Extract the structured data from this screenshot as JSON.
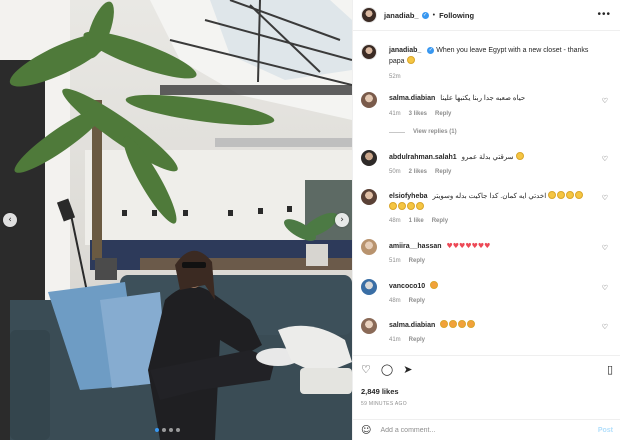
{
  "post": {
    "username": "janadiab_",
    "follow_status": "Following",
    "separator": "•",
    "more_icon": "more-horizontal-icon",
    "caption": "When you leave Egypt with a new closet - thanks papa",
    "caption_emoji": "face-emoji",
    "caption_time": "52m",
    "likes": "2,849 likes",
    "time_ago": "59 MINUTES AGO"
  },
  "comments": [
    {
      "user": "salma.diabian",
      "text": "حياه صعبه جدا ربنا يكتبها علينا",
      "time": "41m",
      "likes": "3 likes",
      "reply": "Reply"
    },
    {
      "user": "abdulrahman.salah1",
      "text": "سرقتي بدلة عمرو",
      "time": "50m",
      "likes": "2 likes",
      "reply": "Reply"
    },
    {
      "user": "elsiofyheba",
      "text": "اخدتي ايه كمان. كدا جاكيت بدله وسويتر",
      "time": "48m",
      "likes": "1 like",
      "reply": "Reply"
    },
    {
      "user": "amiira__hassan",
      "text": "♥♥♥♥♥♥♥",
      "time": "51m",
      "likes": "",
      "reply": "Reply"
    },
    {
      "user": "vancoco10",
      "text": "",
      "time": "48m",
      "likes": "",
      "reply": "Reply"
    },
    {
      "user": "salma.diabian",
      "text": "",
      "time": "41m",
      "likes": "",
      "reply": "Reply"
    }
  ],
  "view_replies": "View replies (1)",
  "add_comment": {
    "placeholder": "Add a comment...",
    "post_label": "Post"
  },
  "icons": {
    "like": "heart-icon",
    "comment": "comment-icon",
    "share": "send-icon",
    "save": "bookmark-icon",
    "emoji": "smiley-icon"
  },
  "colors": {
    "accent": "#3897f0",
    "text": "#262626",
    "muted": "#8e8e8e",
    "heart": "#ed4956",
    "post_disabled": "#b2dffc"
  },
  "carousel": {
    "slides": 4,
    "active_index": 0
  }
}
